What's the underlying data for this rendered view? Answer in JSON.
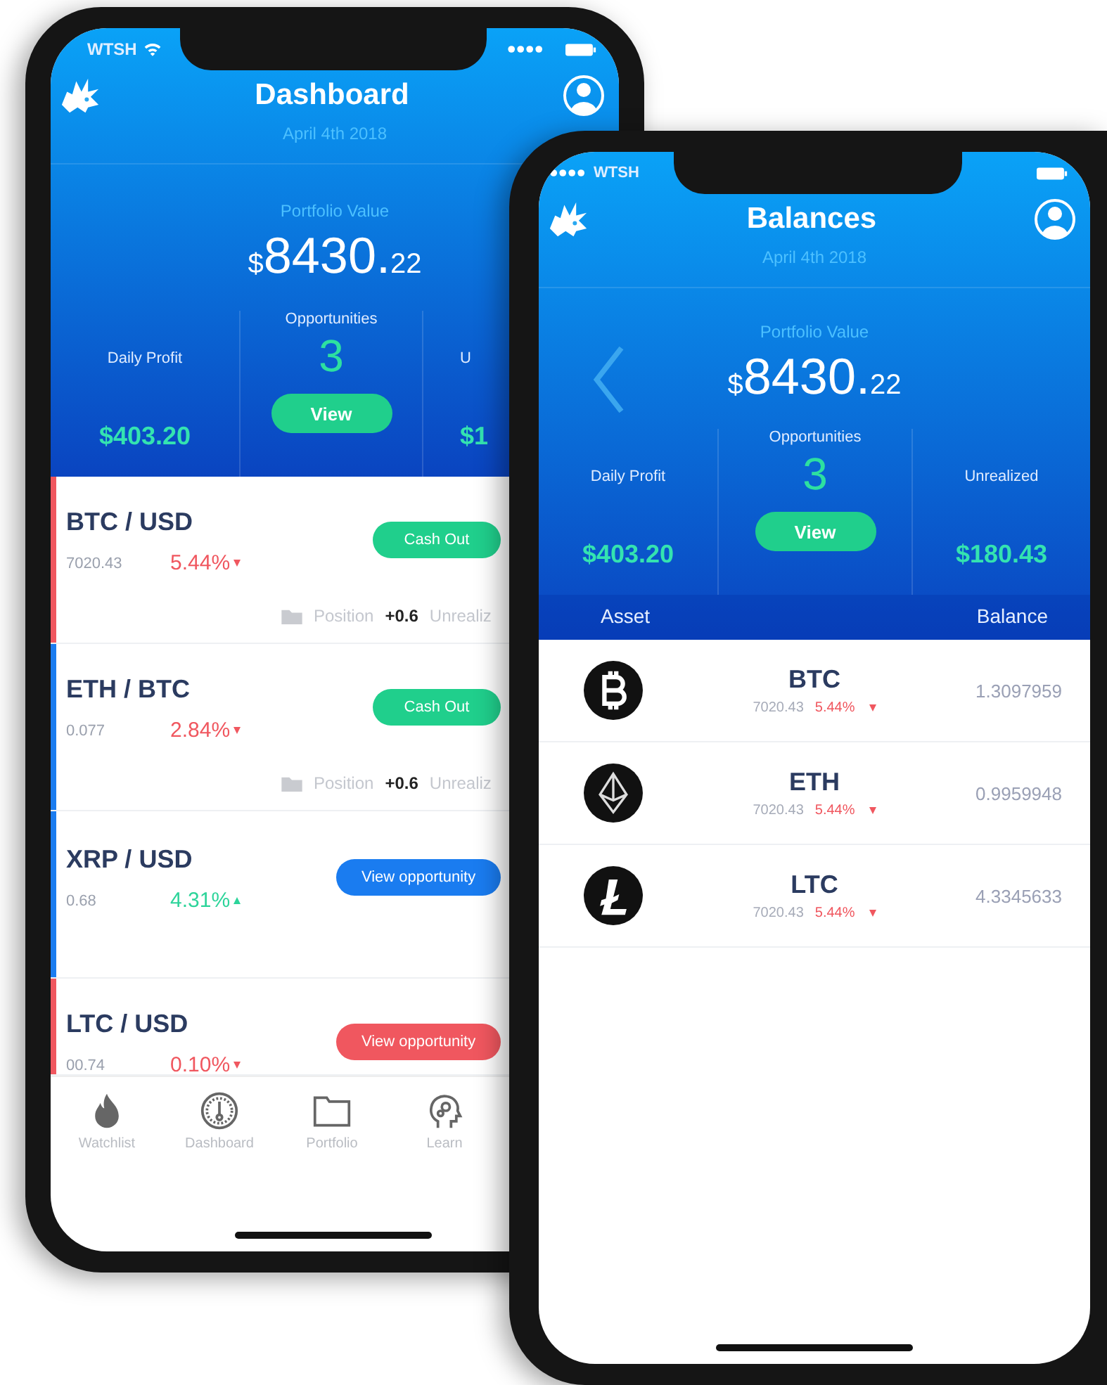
{
  "dashboard_phone": {
    "status_bar": {
      "kind": "carrier_wifi",
      "carrier": "WTSH"
    },
    "title": "Dashboard",
    "date": "April 4th 2018",
    "portfolio": {
      "label": "Portfolio Value",
      "currency": "$",
      "amount": "8430.",
      "cents": "22"
    },
    "stats": [
      {
        "kind": "value",
        "label": "Daily Profit",
        "value": "$403.20"
      },
      {
        "kind": "opportunities",
        "label": "Opportunities",
        "value": "3",
        "button": "View"
      },
      {
        "kind": "value",
        "label": "U",
        "value": "$1"
      }
    ],
    "pairs": [
      {
        "pair": "BTC / USD",
        "price": "7020.43",
        "change": "5.44%",
        "rising": false,
        "color": "#f0575f",
        "action": {
          "kind": "cash_out",
          "label": "Cash Out"
        },
        "position": {
          "label": "Position",
          "value": "+0.6",
          "unrealized": "Unrealiz"
        }
      },
      {
        "pair": "ETH / BTC",
        "price": "0.077",
        "change": "2.84%",
        "rising": false,
        "color": "#1a7cf0",
        "action": {
          "kind": "cash_out",
          "label": "Cash Out"
        },
        "position": {
          "label": "Position",
          "value": "+0.6",
          "unrealized": "Unrealiz"
        }
      },
      {
        "pair": "XRP / USD",
        "price": "0.68",
        "change": "4.31%",
        "rising": true,
        "color": "#1a7cf0",
        "action": {
          "kind": "opportunity",
          "label": "View opportunity"
        }
      },
      {
        "pair": "LTC / USD",
        "price": "00.74",
        "change": "0.10%",
        "rising": false,
        "color": "#f0575f",
        "action": {
          "kind": "opportunity",
          "label": "View opportunity"
        }
      }
    ],
    "tabs": [
      {
        "kind": "flame",
        "label": "Watchlist"
      },
      {
        "kind": "gauge",
        "label": "Dashboard"
      },
      {
        "kind": "folder",
        "label": "Portfolio"
      },
      {
        "kind": "head",
        "label": "Learn"
      }
    ]
  },
  "balances_phone": {
    "status_bar": {
      "kind": "dots_carrier",
      "carrier": "WTSH"
    },
    "title": "Balances",
    "date": "April 4th 2018",
    "portfolio": {
      "label": "Portfolio Value",
      "currency": "$",
      "amount": "8430.",
      "cents": "22"
    },
    "stats": [
      {
        "kind": "value",
        "label": "Daily Profit",
        "value": "$403.20"
      },
      {
        "kind": "opportunities",
        "label": "Opportunities",
        "value": "3",
        "button": "View"
      },
      {
        "kind": "value",
        "label": "Unrealized",
        "value": "$180.43"
      }
    ],
    "table": {
      "columns": [
        "Asset",
        "Balance"
      ],
      "rows": [
        {
          "kind": "btc",
          "symbol": "BTC",
          "price": "7020.43",
          "change": "5.44%",
          "rising": false,
          "balance": "1.3097959"
        },
        {
          "kind": "eth",
          "symbol": "ETH",
          "price": "7020.43",
          "change": "5.44%",
          "rising": false,
          "balance": "0.9959948"
        },
        {
          "kind": "ltc",
          "symbol": "LTC",
          "price": "7020.43",
          "change": "5.44%",
          "rising": false,
          "balance": "4.3345633"
        }
      ]
    }
  }
}
